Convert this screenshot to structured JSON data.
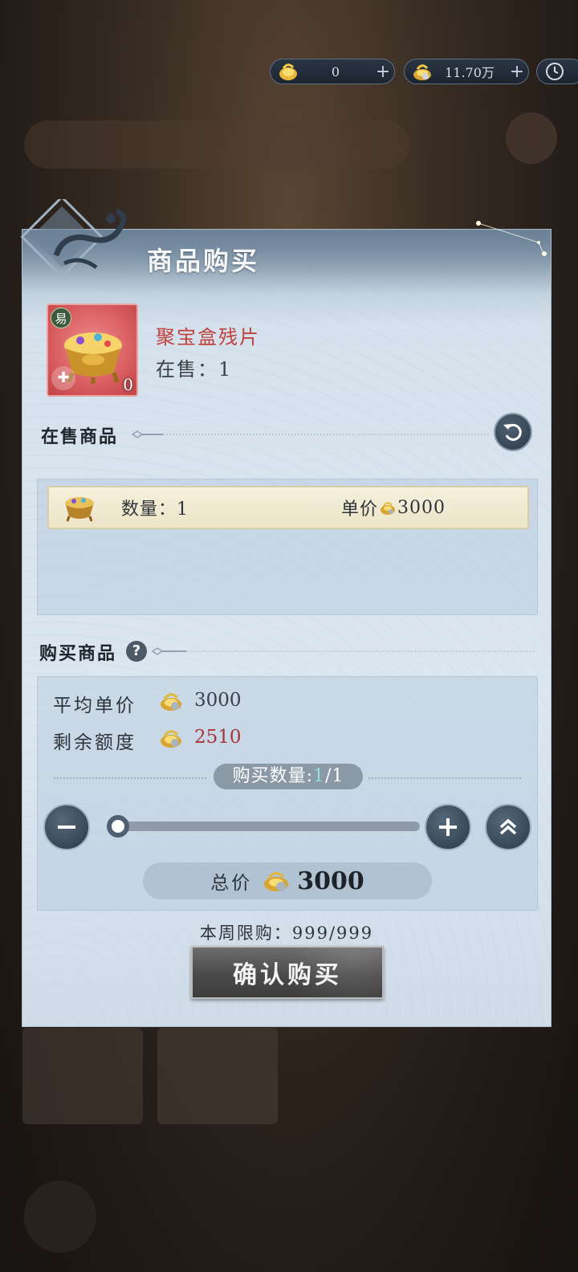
{
  "currency": {
    "coin_a": {
      "icon": "gold-dragon-coin-icon",
      "value": "0"
    },
    "coin_b": {
      "icon": "gold-dragon-ingot-icon",
      "value": "11.70万"
    },
    "plus_symbol": "+",
    "clock_icon": "clock-icon"
  },
  "dialog": {
    "title": "商品购买",
    "item": {
      "name": "聚宝盒残片",
      "stock_label": "在售：1",
      "tag": "易",
      "card_count": "0",
      "icon": "treasure-pot-fragment-icon"
    },
    "on_sale": {
      "title": "在售商品",
      "listings": [
        {
          "qty_label": "数量：1",
          "price_label": "单价",
          "price": "3000"
        }
      ]
    },
    "purchase": {
      "title": "购买商品",
      "help_symbol": "?",
      "avg_price_label": "平均单价",
      "avg_price": "3000",
      "remaining_label": "剩余额度",
      "remaining": "2510",
      "qty_prefix": "购买数量:",
      "qty_current": "1",
      "qty_suffix": "/1",
      "quantity": {
        "current": 1,
        "max": 1
      },
      "total_label": "总价",
      "total": "3000"
    },
    "weekly_limit": "本周限购：999/999",
    "confirm_label": "确认购买"
  },
  "colors": {
    "accent_red": "#c0413c",
    "remaining_red": "#a8343a",
    "qty_highlight": "#8fe0d2"
  }
}
